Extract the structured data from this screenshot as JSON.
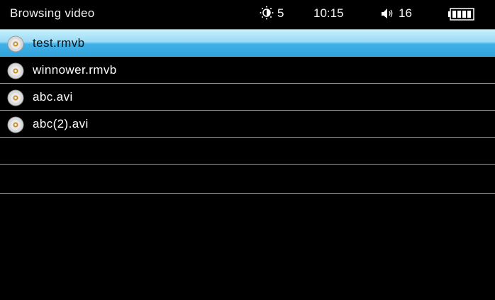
{
  "header": {
    "title": "Browsing video",
    "brightness": "5",
    "time": "10:15",
    "volume": "16"
  },
  "icons": {
    "brightness": "brightness-icon",
    "volume": "speaker-icon",
    "battery": "battery-icon",
    "file": "disc-icon"
  },
  "colors": {
    "selection": "#33a3dc",
    "background": "#000000"
  },
  "files": [
    {
      "name": "test.rmvb",
      "selected": true
    },
    {
      "name": "winnower.rmvb",
      "selected": false
    },
    {
      "name": "abc.avi",
      "selected": false
    },
    {
      "name": "abc(2).avi",
      "selected": false
    }
  ]
}
